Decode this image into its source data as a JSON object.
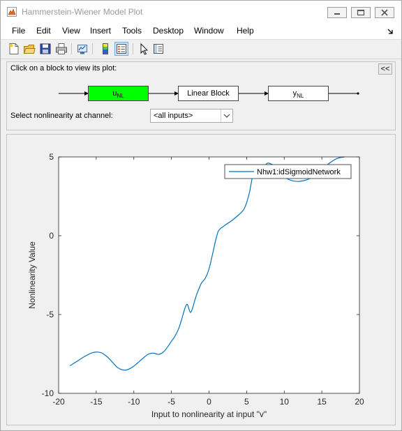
{
  "window": {
    "title": "Hammerstein-Wiener Model Plot",
    "icon": "matlab-figure-icon",
    "controls": {
      "minimize": "minimize-icon",
      "maximize": "maximize-icon",
      "close": "close-icon"
    }
  },
  "menubar": {
    "items": [
      "File",
      "Edit",
      "View",
      "Insert",
      "Tools",
      "Desktop",
      "Window",
      "Help"
    ],
    "dock_icon": "dock-arrow-icon"
  },
  "toolbar": {
    "icons": [
      "new-figure-icon",
      "open-file-icon",
      "save-icon",
      "print-icon",
      "link-plot-icon",
      "colorbar-icon",
      "legend-icon",
      "pointer-icon",
      "property-inspector-icon"
    ]
  },
  "model_panel": {
    "hint": "Click on a block to view its plot:",
    "collapse_label": "<<",
    "blocks": {
      "input_nl": {
        "main": "u",
        "sub": "NL"
      },
      "linear": "Linear Block",
      "output_nl": {
        "main": "y",
        "sub": "NL"
      }
    },
    "channel_label": "Select nonlinearity at channel:",
    "channel_value": "<all inputs>"
  },
  "colors": {
    "active_block": "#00ff00",
    "line": "#0072bd",
    "axes": "#262626"
  },
  "chart_data": {
    "type": "line",
    "xlabel": "Input to nonlinearity at input \"v\"",
    "ylabel": "Nonlinearity Value",
    "xlim": [
      -20,
      20
    ],
    "ylim": [
      -10,
      5
    ],
    "xticks": [
      -20,
      -15,
      -10,
      -5,
      0,
      5,
      10,
      15,
      20
    ],
    "yticks": [
      -10,
      -5,
      0,
      5
    ],
    "grid": false,
    "legend_placement": "top-right",
    "series": [
      {
        "name": "Nhw1:idSigmoidNetwork",
        "x": [
          -18.5,
          -17.5,
          -16.5,
          -15.5,
          -14.8,
          -14.2,
          -13.5,
          -12.8,
          -12.2,
          -11.6,
          -11.0,
          -10.4,
          -9.8,
          -9.2,
          -8.6,
          -8.0,
          -7.4,
          -7.0,
          -6.6,
          -6.0,
          -5.5,
          -5.0,
          -4.5,
          -4.0,
          -3.6,
          -3.2,
          -2.9,
          -2.6,
          -2.4,
          -2.1,
          -1.8,
          -1.5,
          -1.0,
          -0.5,
          0.0,
          0.5,
          0.9,
          1.2,
          1.5,
          1.8,
          2.2,
          3.0,
          4.0,
          4.6,
          5.0,
          5.4,
          5.8,
          6.0,
          6.5,
          7.0,
          7.5,
          8.0,
          9.0,
          10.0,
          11.0,
          12.0,
          13.0,
          14.0,
          15.0,
          16.0,
          17.0,
          18.0
        ],
        "y": [
          -8.25,
          -7.95,
          -7.65,
          -7.42,
          -7.38,
          -7.45,
          -7.7,
          -8.05,
          -8.35,
          -8.5,
          -8.52,
          -8.4,
          -8.2,
          -7.95,
          -7.7,
          -7.5,
          -7.45,
          -7.5,
          -7.52,
          -7.35,
          -7.05,
          -6.7,
          -6.35,
          -5.85,
          -5.25,
          -4.6,
          -4.35,
          -4.75,
          -4.85,
          -4.45,
          -3.95,
          -3.55,
          -3.0,
          -2.7,
          -2.1,
          -1.1,
          -0.25,
          0.25,
          0.45,
          0.55,
          0.7,
          0.95,
          1.35,
          1.65,
          2.1,
          2.8,
          3.8,
          4.0,
          4.1,
          4.2,
          4.5,
          4.6,
          4.3,
          3.75,
          3.5,
          3.45,
          3.55,
          3.8,
          4.2,
          4.6,
          4.9,
          5.0
        ]
      }
    ]
  }
}
